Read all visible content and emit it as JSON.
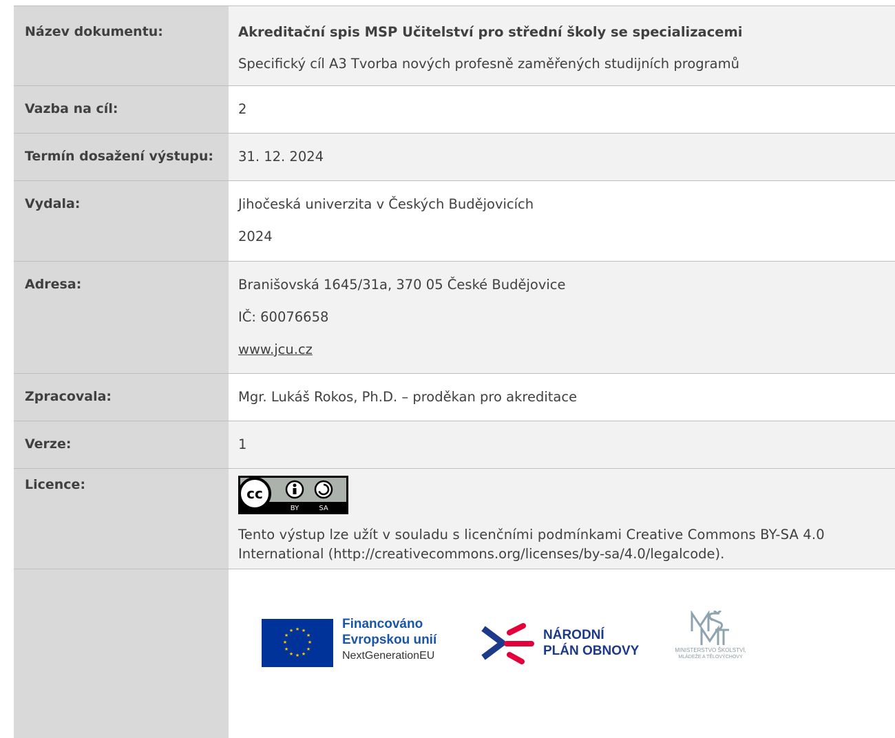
{
  "rows": {
    "document": {
      "label": "Název dokumentu:",
      "title": "Akreditační spis MSP Učitelství pro střední školy se specializacemi",
      "subtitle": "Specifický cíl A3 Tvorba nových profesně zaměřených studijních programů"
    },
    "goal": {
      "label": "Vazba na cíl:",
      "value": "2"
    },
    "deadline": {
      "label": "Termín dosažení výstupu:",
      "value": "31. 12. 2024"
    },
    "issued": {
      "label": "Vydala:",
      "org": "Jihočeská univerzita v Českých Budějovicích",
      "year": "2024"
    },
    "address": {
      "label": "Adresa:",
      "street": "Branišovská 1645/31a, 370 05 České Budějovice",
      "ico": "IČ: 60076658",
      "web": "www.jcu.cz"
    },
    "processed": {
      "label": "Zpracovala:",
      "value": "Mgr. Lukáš Rokos, Ph.D. – proděkan pro akreditace"
    },
    "version": {
      "label": "Verze:",
      "value": "1"
    },
    "license": {
      "label": "Licence:",
      "badge": {
        "by": "BY",
        "sa": "SA"
      },
      "text_line1": "Tento výstup lze užít v souladu s licenčními podmínkami Creative Commons BY-SA 4.0",
      "text_line2": "International (http://creativecommons.org/licenses/by-sa/4.0/legalcode)."
    }
  },
  "logos": {
    "eu_line1": "Financováno",
    "eu_line2": "Evropskou unií",
    "eu_line3": "NextGenerationEU",
    "npo_line1": "NÁRODNÍ",
    "npo_line2": "PLÁN OBNOVY",
    "msmt_line1": "MINISTERSTVO ŠKOLSTVÍ,",
    "msmt_line2": "MLÁDEŽE A TĚLOVÝCHOVY"
  },
  "colors": {
    "label_bg": "#d9d9d9",
    "alt_value_bg": "#f2f2f2",
    "eu_blue": "#003399",
    "eu_yellow": "#ffcc00",
    "npo_blue": "#1d3a8a",
    "npo_red": "#e4003a",
    "link": "#1f4fbf"
  }
}
